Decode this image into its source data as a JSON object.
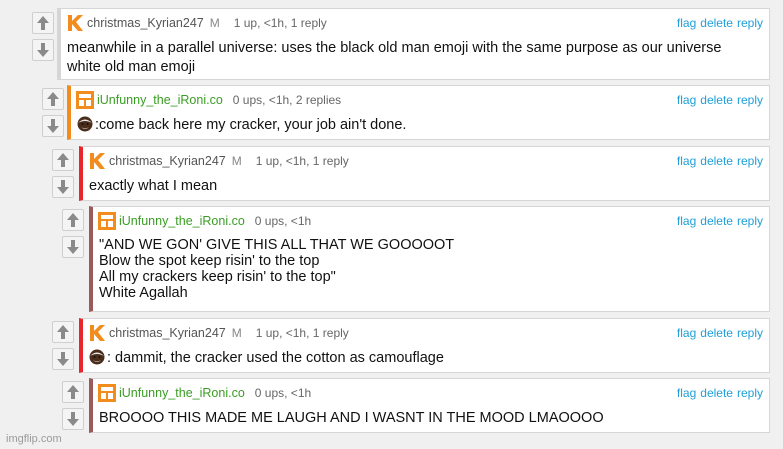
{
  "colors": {
    "link": "#1e9fd8",
    "green_user": "#3a9d23",
    "orange_accent": "#f28c1d",
    "red_accent": "#e8262c",
    "mauve_accent": "#9c5a5a"
  },
  "actions": {
    "flag": "flag",
    "delete": "delete",
    "reply": "reply"
  },
  "comments": [
    {
      "username": "christmas_Kyrian247",
      "badge": "M",
      "stats": "1 up, <1h, 1 reply",
      "avatar": "k-logo-icon",
      "lines": [
        "meanwhile in a parallel universe: uses the black old man emoji with the same purpose as our universe",
        "white old man emoji"
      ]
    },
    {
      "username": "iUnfunny_the_iRoni.co",
      "stats": "0 ups, <1h, 2 replies",
      "avatar": "calculator-icon",
      "lines": [
        ":come back here my cracker, your job ain't done."
      ]
    },
    {
      "username": "christmas_Kyrian247",
      "badge": "M",
      "stats": "1 up, <1h, 1 reply",
      "avatar": "k-logo-icon",
      "lines": [
        "exactly what I mean"
      ]
    },
    {
      "username": "iUnfunny_the_iRoni.co",
      "stats": "0 ups, <1h",
      "avatar": "calculator-icon",
      "lines": [
        "\"AND WE GON' GIVE THIS ALL THAT WE GOOOOOT",
        "Blow the spot keep risin' to the top",
        "All my crackers keep risin' to the top\"",
        "White Agallah"
      ]
    },
    {
      "username": "christmas_Kyrian247",
      "badge": "M",
      "stats": "1 up, <1h, 1 reply",
      "avatar": "k-logo-icon",
      "lines": [
        ": dammit, the cracker used the cotton as camouflage"
      ]
    },
    {
      "username": "iUnfunny_the_iRoni.co",
      "stats": "0 ups, <1h",
      "avatar": "calculator-icon",
      "lines": [
        "BROOOO THIS MADE ME LAUGH AND I WASNT IN THE MOOD LMAOOOO"
      ]
    }
  ],
  "watermark": "imgflip.com"
}
